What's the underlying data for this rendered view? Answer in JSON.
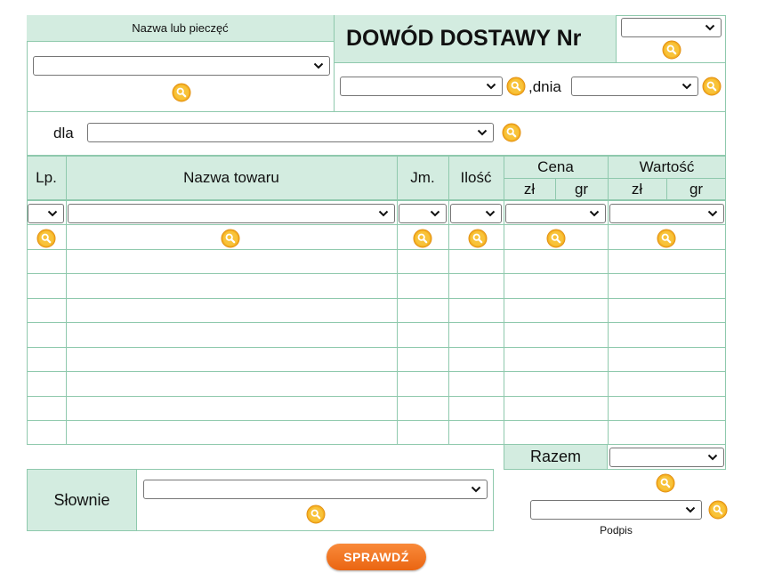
{
  "header": {
    "seal_label": "Nazwa lub pieczęć",
    "title": "DOWÓD DOSTAWY Nr",
    "date_label": ",dnia",
    "for_label": "dla"
  },
  "table": {
    "col_lp": "Lp.",
    "col_name": "Nazwa towaru",
    "col_unit": "Jm.",
    "col_qty": "Ilość",
    "col_price": "Cena",
    "col_value": "Wartość",
    "sub_zl": "zł",
    "sub_gr": "gr",
    "sub_zl2": "zł",
    "sub_gr2": "gr"
  },
  "footer": {
    "total_label": "Razem",
    "words_label": "Słownie",
    "signature_label": "Podpis",
    "check_button": "SPRAWDŹ"
  },
  "icons": {
    "search": "magnifier-icon",
    "dropdown": "chevron-down-icon"
  },
  "colors": {
    "header_green": "#d3ece0",
    "border_green": "#8fc9ad",
    "icon_orange": "#f5a623",
    "button_orange": "#ea6512"
  }
}
